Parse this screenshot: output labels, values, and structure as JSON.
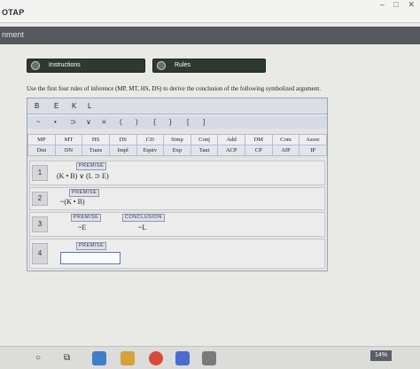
{
  "app": {
    "brand": "OTAP",
    "section": "nment"
  },
  "tabs": [
    {
      "label": "Instructions"
    },
    {
      "label": "Rules"
    }
  ],
  "instruction": "Use the first four rules of inference (MP, MT, HS, DS) to derive the conclusion of the following symbolized argument.",
  "toolbar_letters": [
    "B",
    "E",
    "K",
    "L"
  ],
  "symbols": [
    "~",
    "•",
    "⊃",
    "∨",
    "≡",
    "(",
    ")",
    "{",
    "}",
    "[",
    "]"
  ],
  "rules_row1": [
    "MP",
    "MT",
    "HS",
    "DS",
    "CD",
    "Simp",
    "Conj",
    "Add",
    "DM",
    "Com",
    "Assoc"
  ],
  "rules_row2": [
    "Dist",
    "DN",
    "Trans",
    "Impl",
    "Equiv",
    "Exp",
    "Taut",
    "ACP",
    "CP",
    "AIP",
    "IP"
  ],
  "lines": [
    {
      "num": "1",
      "tag": "PREMISE",
      "expr": "(K • B) ∨ (L ⊃ E)"
    },
    {
      "num": "2",
      "tag": "PREMISE",
      "expr": "~(K • B)"
    },
    {
      "num": "3",
      "tag": "PREMISE",
      "expr": "~E",
      "ctag": "CONCLUSION",
      "cexpr": "~L"
    },
    {
      "num": "4",
      "tag": "PREMISE",
      "expr": ""
    }
  ],
  "taskbar": {
    "counter": "14%"
  },
  "colors": {
    "accent": "#5a78b8",
    "panel_border": "#9aa4b6",
    "pill_bg": "#2f3a2e"
  }
}
